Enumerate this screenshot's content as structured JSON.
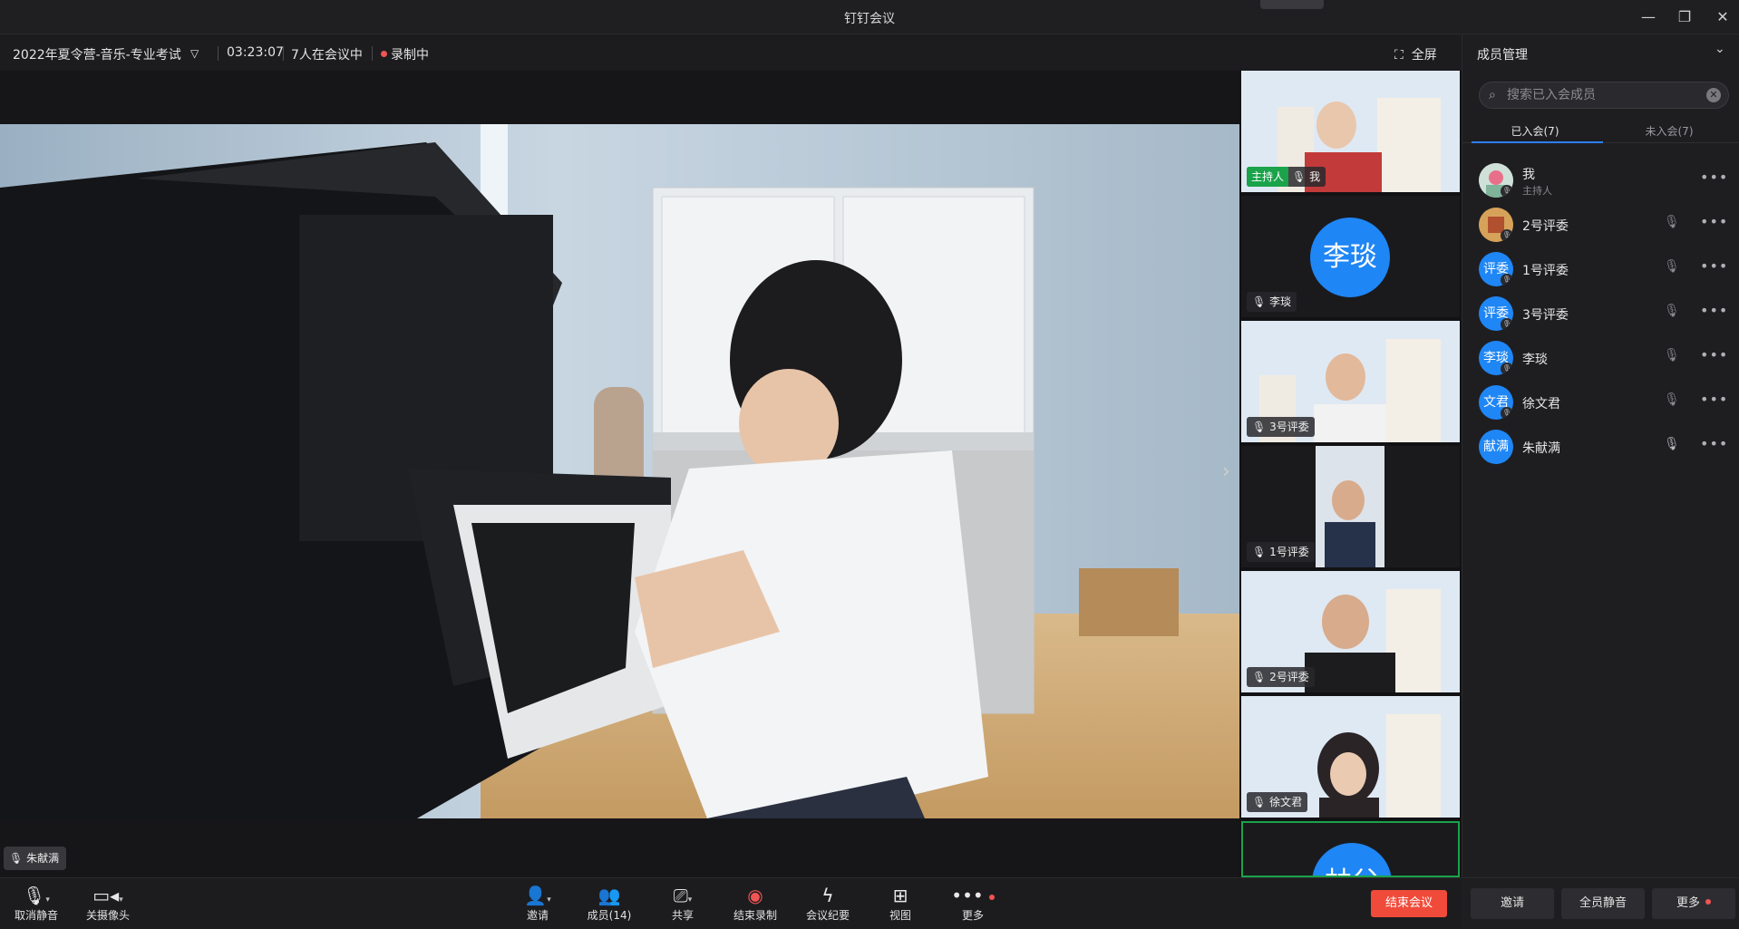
{
  "window": {
    "title": "钉钉会议"
  },
  "topbar": {
    "meeting_name": "2022年夏令营-音乐-专业考试",
    "duration": "03:23:07",
    "participants_in": "7人在会议中",
    "recording": "录制中",
    "fullscreen": "全屏"
  },
  "stage": {
    "speaker_name": "朱献满"
  },
  "tiles": [
    {
      "label": "我",
      "host_badge": "主持人"
    },
    {
      "label": "李琰",
      "avatar_text": "李琰"
    },
    {
      "label": "3号评委"
    },
    {
      "label": "1号评委"
    },
    {
      "label": "2号评委"
    },
    {
      "label": "徐文君"
    },
    {
      "label": "",
      "avatar_text": "林父吉"
    }
  ],
  "panel": {
    "title": "成员管理",
    "search_placeholder": "搜索已入会成员",
    "tab_joined": "已入会(7)",
    "tab_not_joined": "未入会(7)",
    "members": [
      {
        "name": "我",
        "role": "主持人",
        "avatar": "",
        "muted": false
      },
      {
        "name": "2号评委",
        "avatar": "",
        "muted": true
      },
      {
        "name": "1号评委",
        "avatar": "评委",
        "muted": true
      },
      {
        "name": "3号评委",
        "avatar": "评委",
        "muted": true
      },
      {
        "name": "李琰",
        "avatar": "李琰",
        "muted": true
      },
      {
        "name": "徐文君",
        "avatar": "文君",
        "muted": true
      },
      {
        "name": "朱献满",
        "avatar": "献满",
        "muted": false
      }
    ],
    "btn_invite": "邀请",
    "btn_mute_all": "全员静音",
    "btn_more": "更多"
  },
  "toolbar": {
    "unmute": "取消静音",
    "camera_off": "关摄像头",
    "invite": "邀请",
    "members": "成员(14)",
    "share": "共享",
    "stop_record": "结束录制",
    "minutes": "会议纪要",
    "view": "视图",
    "more": "更多",
    "end_meeting": "结束会议"
  }
}
